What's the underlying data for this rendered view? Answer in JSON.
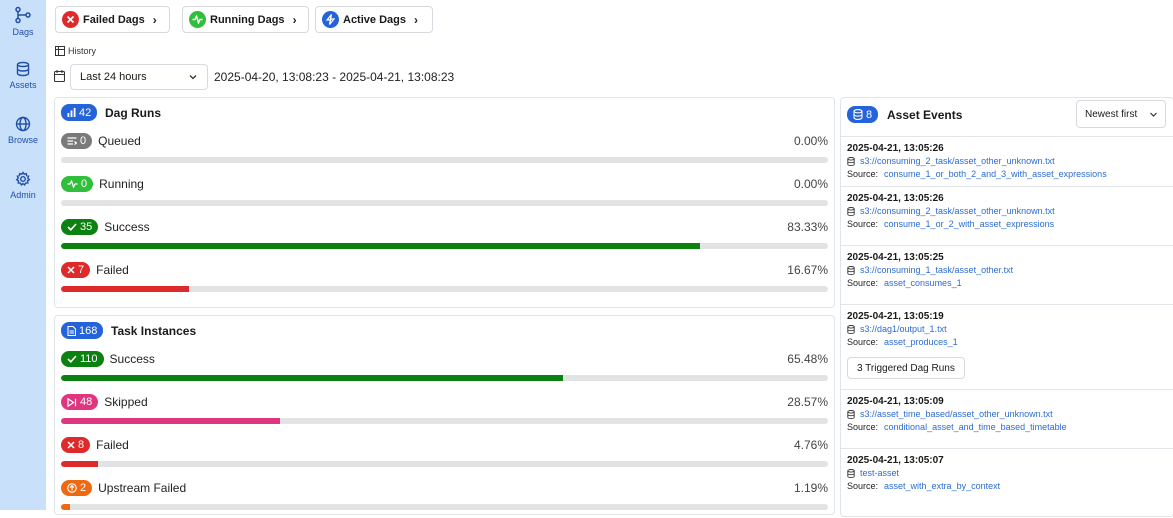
{
  "sidebar": {
    "items": [
      {
        "label": "Dags",
        "icon": "dag-icon"
      },
      {
        "label": "Assets",
        "icon": "database-icon"
      },
      {
        "label": "Browse",
        "icon": "globe-icon"
      },
      {
        "label": "Admin",
        "icon": "gear-icon"
      }
    ]
  },
  "top_buttons": {
    "failed": "Failed Dags",
    "running": "Running Dags",
    "active": "Active Dags"
  },
  "history": {
    "label": "History",
    "range_select": "Last 24 hours",
    "date_range": "2025-04-20, 13:08:23 - 2025-04-21, 13:08:23"
  },
  "dag_runs": {
    "count": "42",
    "title": "Dag Runs",
    "rows": [
      {
        "count": "0",
        "label": "Queued",
        "pct": "0.00%",
        "fraction": 0.0,
        "color": "#7a7a7a"
      },
      {
        "count": "0",
        "label": "Running",
        "pct": "0.00%",
        "fraction": 0.0,
        "color": "#2fbf3b"
      },
      {
        "count": "35",
        "label": "Success",
        "pct": "83.33%",
        "fraction": 0.8333,
        "color": "#0b8210"
      },
      {
        "count": "7",
        "label": "Failed",
        "pct": "16.67%",
        "fraction": 0.1667,
        "color": "#dd2a2a"
      }
    ]
  },
  "task_instances": {
    "count": "168",
    "title": "Task Instances",
    "rows": [
      {
        "count": "110",
        "label": "Success",
        "pct": "65.48%",
        "fraction": 0.6548,
        "color": "#0b8210"
      },
      {
        "count": "48",
        "label": "Skipped",
        "pct": "28.57%",
        "fraction": 0.2857,
        "color": "#e0367f"
      },
      {
        "count": "8",
        "label": "Failed",
        "pct": "4.76%",
        "fraction": 0.0476,
        "color": "#dd2a2a"
      },
      {
        "count": "2",
        "label": "Upstream Failed",
        "pct": "1.19%",
        "fraction": 0.0119,
        "color": "#ee6a12"
      }
    ]
  },
  "asset_events": {
    "count": "8",
    "title": "Asset Events",
    "sort": "Newest first",
    "source_label": "Source:",
    "events": [
      {
        "ts": "2025-04-21, 13:05:26",
        "uri": "s3://consuming_2_task/asset_other_unknown.txt",
        "source": "consume_1_or_both_2_and_3_with_asset_expressions"
      },
      {
        "ts": "2025-04-21, 13:05:26",
        "uri": "s3://consuming_2_task/asset_other_unknown.txt",
        "source": "consume_1_or_2_with_asset_expressions"
      },
      {
        "ts": "2025-04-21, 13:05:25",
        "uri": "s3://consuming_1_task/asset_other.txt",
        "source": "asset_consumes_1"
      },
      {
        "ts": "2025-04-21, 13:05:19",
        "uri": "s3://dag1/output_1.txt",
        "source": "asset_produces_1",
        "button": "3 Triggered Dag Runs"
      },
      {
        "ts": "2025-04-21, 13:05:09",
        "uri": "s3://asset_time_based/asset_other_unknown.txt",
        "source": "conditional_asset_and_time_based_timetable"
      },
      {
        "ts": "2025-04-21, 13:05:07",
        "uri": "test-asset",
        "source": "asset_with_extra_by_context"
      }
    ]
  },
  "colors": {
    "sidebar_bg": "#c9e0fb",
    "accent_blue": "#2563d9",
    "failed_red": "#dd2a2a",
    "success_green": "#0b8210",
    "running_green": "#2fbf3b",
    "skipped_pink": "#e0367f",
    "upstream_orange": "#ee6a12",
    "queued_gray": "#7a7a7a"
  }
}
